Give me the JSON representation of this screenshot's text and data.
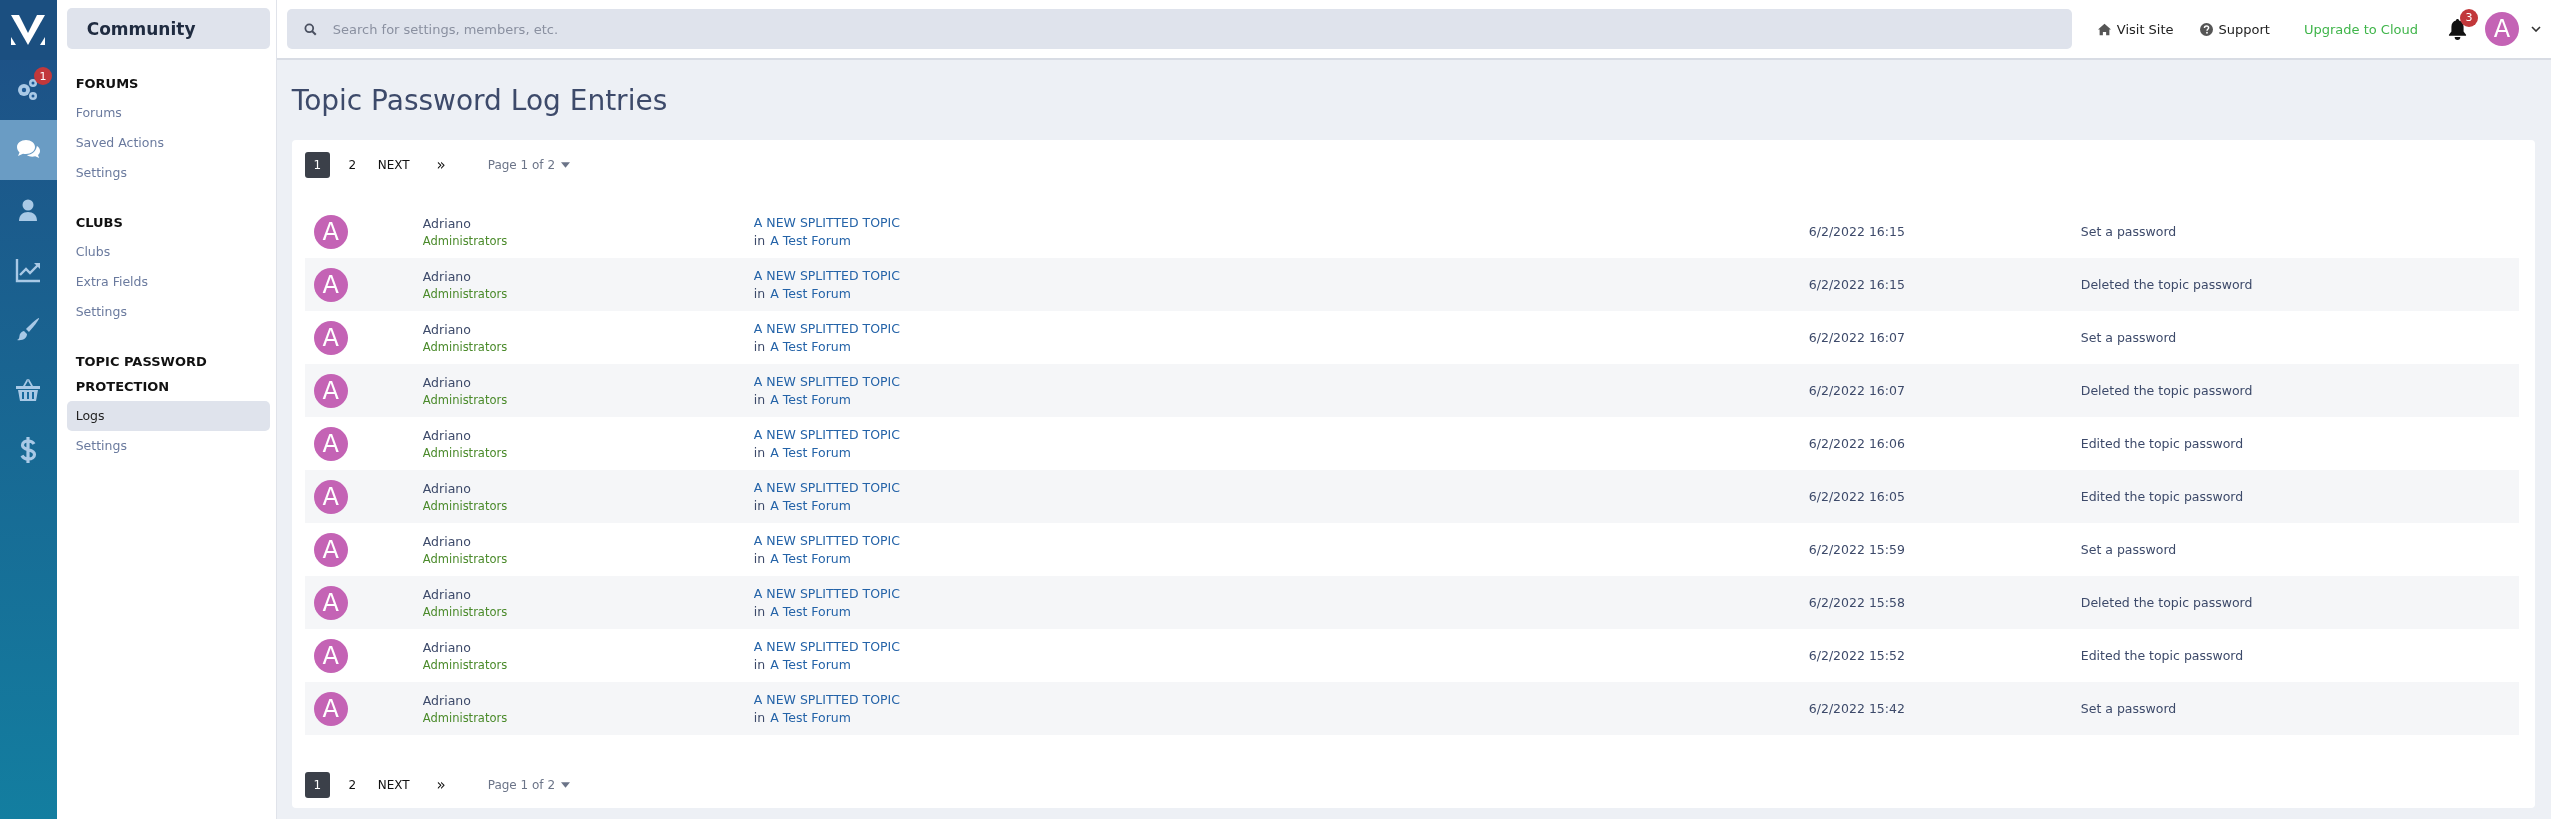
{
  "nav_items": [
    {
      "selected": false,
      "badge": "1"
    },
    {
      "selected": true
    },
    {
      "selected": false
    },
    {
      "selected": false
    },
    {
      "selected": false
    },
    {
      "selected": false
    },
    {
      "selected": false
    }
  ],
  "sidebar": {
    "title": "Community",
    "sections": [
      {
        "heading": "FORUMS",
        "items": [
          {
            "label": "Forums",
            "selected": false
          },
          {
            "label": "Saved Actions",
            "selected": false
          },
          {
            "label": "Settings",
            "selected": false
          }
        ]
      },
      {
        "heading": "CLUBS",
        "items": [
          {
            "label": "Clubs",
            "selected": false
          },
          {
            "label": "Extra Fields",
            "selected": false
          },
          {
            "label": "Settings",
            "selected": false
          }
        ]
      },
      {
        "heading": "TOPIC PASSWORD PROTECTION",
        "items": [
          {
            "label": "Logs",
            "selected": true
          },
          {
            "label": "Settings",
            "selected": false
          }
        ]
      }
    ]
  },
  "top_bar": {
    "search": {
      "placeholder": "Search for settings, members, etc."
    },
    "links": [
      {
        "label": "Visit Site",
        "kind": "home"
      },
      {
        "label": "Support",
        "kind": "help"
      },
      {
        "label": "Upgrade to Cloud",
        "kind": "upgrade"
      }
    ],
    "notifications": {
      "badge": "3"
    },
    "user_avatar": "A"
  },
  "page_title": "Topic Password Log Entries",
  "pagination": [
    {
      "pages": [
        {
          "label": "1",
          "selected": true
        },
        {
          "label": "2",
          "selected": false
        }
      ],
      "next": "NEXT",
      "last": "»",
      "page_jump": "Page 1 of 2"
    },
    {
      "pages": [
        {
          "label": "1",
          "selected": true
        },
        {
          "label": "2",
          "selected": false
        }
      ],
      "next": "NEXT",
      "last": "»",
      "page_jump": "Page 1 of 2"
    }
  ],
  "rows": [
    {
      "avatar": "A",
      "name": "Adriano",
      "group": "Administrators",
      "topic": "A NEW SPLITTED TOPIC",
      "forum_prefix": "in",
      "forum": "A Test Forum",
      "date": "6/2/2022 16:15",
      "action": "Set a password"
    },
    {
      "avatar": "A",
      "name": "Adriano",
      "group": "Administrators",
      "topic": "A NEW SPLITTED TOPIC",
      "forum_prefix": "in",
      "forum": "A Test Forum",
      "date": "6/2/2022 16:15",
      "action": "Deleted the topic password"
    },
    {
      "avatar": "A",
      "name": "Adriano",
      "group": "Administrators",
      "topic": "A NEW SPLITTED TOPIC",
      "forum_prefix": "in",
      "forum": "A Test Forum",
      "date": "6/2/2022 16:07",
      "action": "Set a password"
    },
    {
      "avatar": "A",
      "name": "Adriano",
      "group": "Administrators",
      "topic": "A NEW SPLITTED TOPIC",
      "forum_prefix": "in",
      "forum": "A Test Forum",
      "date": "6/2/2022 16:07",
      "action": "Deleted the topic password"
    },
    {
      "avatar": "A",
      "name": "Adriano",
      "group": "Administrators",
      "topic": "A NEW SPLITTED TOPIC",
      "forum_prefix": "in",
      "forum": "A Test Forum",
      "date": "6/2/2022 16:06",
      "action": "Edited the topic password"
    },
    {
      "avatar": "A",
      "name": "Adriano",
      "group": "Administrators",
      "topic": "A NEW SPLITTED TOPIC",
      "forum_prefix": "in",
      "forum": "A Test Forum",
      "date": "6/2/2022 16:05",
      "action": "Edited the topic password"
    },
    {
      "avatar": "A",
      "name": "Adriano",
      "group": "Administrators",
      "topic": "A NEW SPLITTED TOPIC",
      "forum_prefix": "in",
      "forum": "A Test Forum",
      "date": "6/2/2022 15:59",
      "action": "Set a password"
    },
    {
      "avatar": "A",
      "name": "Adriano",
      "group": "Administrators",
      "topic": "A NEW SPLITTED TOPIC",
      "forum_prefix": "in",
      "forum": "A Test Forum",
      "date": "6/2/2022 15:58",
      "action": "Deleted the topic password"
    },
    {
      "avatar": "A",
      "name": "Adriano",
      "group": "Administrators",
      "topic": "A NEW SPLITTED TOPIC",
      "forum_prefix": "in",
      "forum": "A Test Forum",
      "date": "6/2/2022 15:52",
      "action": "Edited the topic password"
    },
    {
      "avatar": "A",
      "name": "Adriano",
      "group": "Administrators",
      "topic": "A NEW SPLITTED TOPIC",
      "forum_prefix": "in",
      "forum": "A Test Forum",
      "date": "6/2/2022 15:42",
      "action": "Set a password"
    }
  ]
}
